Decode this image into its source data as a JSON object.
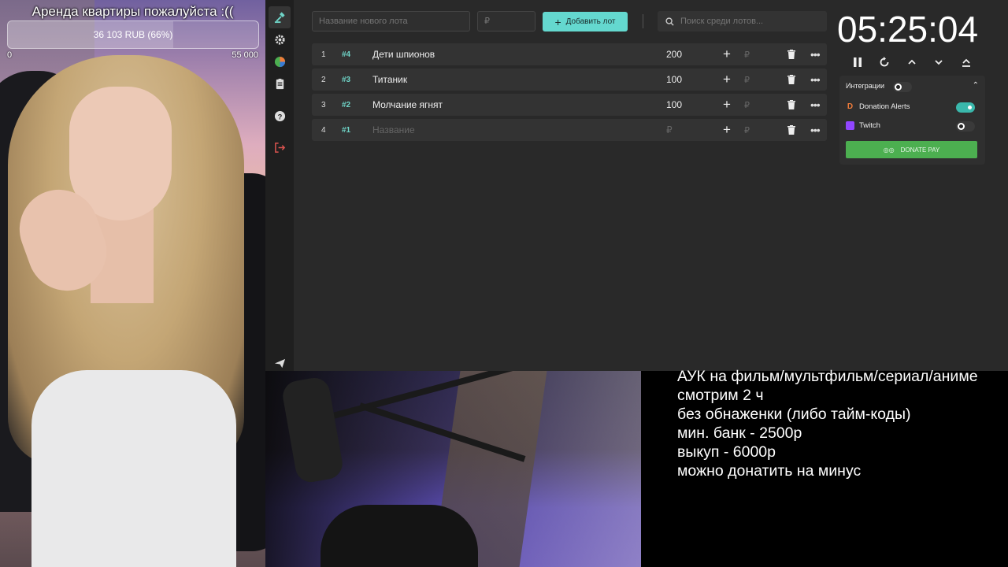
{
  "goal": {
    "title": "Аренда квартиры пожалуйста :((",
    "progress_text": "36 103 RUB (66%)",
    "progress_fraction": 0.66,
    "min_label": "0",
    "max_label": "55 000"
  },
  "sidebar": {
    "items": [
      {
        "icon": "hammer-icon"
      },
      {
        "icon": "gear-icon"
      },
      {
        "icon": "pie-chart-icon"
      },
      {
        "icon": "clipboard-icon"
      },
      {
        "icon": "help-icon"
      },
      {
        "icon": "logout-icon"
      },
      {
        "icon": "send-icon"
      }
    ]
  },
  "toolbar": {
    "lot_name_placeholder": "Название нового лота",
    "amount_placeholder": "₽",
    "add_label": "Добавить лот",
    "search_placeholder": "Поиск среди лотов..."
  },
  "lots": [
    {
      "num": "1",
      "tag": "#4",
      "name": "Дети шпионов",
      "amount": "200"
    },
    {
      "num": "2",
      "tag": "#3",
      "name": "Титаник",
      "amount": "100"
    },
    {
      "num": "3",
      "tag": "#2",
      "name": "Молчание ягнят",
      "amount": "100"
    }
  ],
  "new_lot": {
    "num": "4",
    "tag": "#1",
    "name_placeholder": "Название",
    "amount_placeholder": "₽"
  },
  "rub_symbol": "₽",
  "dots": "•••",
  "timer": {
    "value": "05:25:04"
  },
  "integrations": {
    "title": "Интеграции",
    "items": [
      {
        "name": "Donation Alerts",
        "enabled": true
      },
      {
        "name": "Twitch",
        "enabled": false
      }
    ],
    "donatepay_label": "DONATE PAY"
  },
  "rules": [
    "АУК на фильм/мультфильм/сериал/аниме",
    "смотрим 2 ч",
    "без обнаженки (либо тайм-коды)",
    "мин. банк - 2500р",
    "выкуп - 6000р",
    "можно донатить на минус"
  ],
  "colors": {
    "accent": "#64d8cf",
    "donatepay": "#4caf50",
    "twitch": "#9146ff",
    "donationalerts": "#f07c3a"
  }
}
